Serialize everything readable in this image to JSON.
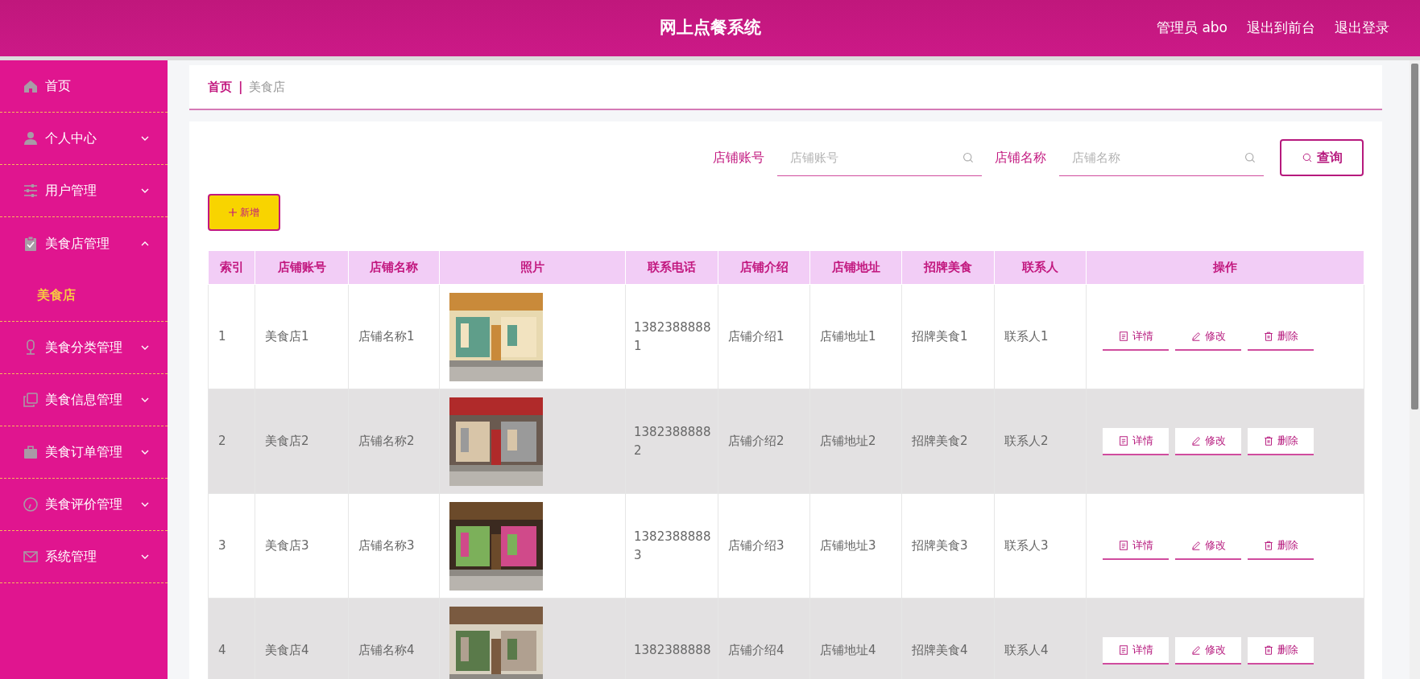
{
  "header": {
    "title": "网上点餐系统",
    "links": [
      "管理员 abo",
      "退出到前台",
      "退出登录"
    ]
  },
  "sidebar": {
    "items": [
      {
        "label": "首页",
        "kind": "link"
      },
      {
        "label": "个人中心",
        "kind": "menu",
        "expanded": false
      },
      {
        "label": "用户管理",
        "kind": "menu",
        "expanded": false
      },
      {
        "label": "美食店管理",
        "kind": "menu",
        "expanded": true,
        "children": [
          {
            "label": "美食店",
            "selected": true
          }
        ]
      },
      {
        "label": "美食分类管理",
        "kind": "menu",
        "expanded": false
      },
      {
        "label": "美食信息管理",
        "kind": "menu",
        "expanded": false
      },
      {
        "label": "美食订单管理",
        "kind": "menu",
        "expanded": false
      },
      {
        "label": "美食评价管理",
        "kind": "menu",
        "expanded": false
      },
      {
        "label": "系统管理",
        "kind": "menu",
        "expanded": false
      }
    ]
  },
  "breadcrumb": {
    "items": [
      "首页",
      "美食店"
    ],
    "separator": "|"
  },
  "search": {
    "fields": [
      {
        "label": "店铺账号",
        "placeholder": "店铺账号"
      },
      {
        "label": "店铺名称",
        "placeholder": "店铺名称"
      }
    ],
    "button": "查询"
  },
  "add_button": "新增",
  "table": {
    "columns": [
      "索引",
      "店铺账号",
      "店铺名称",
      "照片",
      "联系电话",
      "店铺介绍",
      "店铺地址",
      "招牌美食",
      "联系人",
      "操作"
    ],
    "rows": [
      {
        "index": "1",
        "account": "美食店1",
        "name": "店铺名称1",
        "photo": {
          "kind": "picture"
        },
        "phone": "13823888881",
        "intro": "店铺介绍1",
        "address": "店铺地址1",
        "signature": "招牌美食1",
        "contact": "联系人1",
        "actions": [
          "详情",
          "修改",
          "删除"
        ]
      },
      {
        "index": "2",
        "account": "美食店2",
        "name": "店铺名称2",
        "photo": {
          "kind": "picture"
        },
        "phone": "13823888882",
        "intro": "店铺介绍2",
        "address": "店铺地址2",
        "signature": "招牌美食2",
        "contact": "联系人2",
        "actions": [
          "详情",
          "修改",
          "删除"
        ]
      },
      {
        "index": "3",
        "account": "美食店3",
        "name": "店铺名称3",
        "photo": {
          "kind": "picture"
        },
        "phone": "13823888883",
        "intro": "店铺介绍3",
        "address": "店铺地址3",
        "signature": "招牌美食3",
        "contact": "联系人3",
        "actions": [
          "详情",
          "修改",
          "删除"
        ]
      },
      {
        "index": "4",
        "account": "美食店4",
        "name": "店铺名称4",
        "photo": {
          "kind": "picture"
        },
        "phone": "1382388888",
        "intro": "店铺介绍4",
        "address": "店铺地址4",
        "signature": "招牌美食4",
        "contact": "联系人4",
        "actions": [
          "详情",
          "修改",
          "删除"
        ]
      }
    ]
  }
}
